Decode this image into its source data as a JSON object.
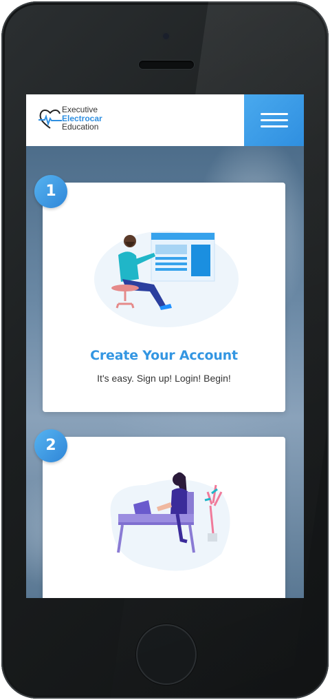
{
  "header": {
    "logo": {
      "line1": "Executive",
      "line2": "Electrocar",
      "line3": "Education"
    },
    "menu_icon": "hamburger-menu-icon"
  },
  "steps": [
    {
      "number": "1",
      "title": "Create Your Account",
      "description": "It's easy. Sign up! Login! Begin!",
      "illustration": "man-at-whiteboard-illustration"
    },
    {
      "number": "2",
      "title": "",
      "description": "",
      "illustration": "woman-at-laptop-illustration"
    }
  ],
  "colors": {
    "accent": "#3396e2",
    "menu_button": "#49a9ee",
    "badge": "#3a95e2"
  }
}
